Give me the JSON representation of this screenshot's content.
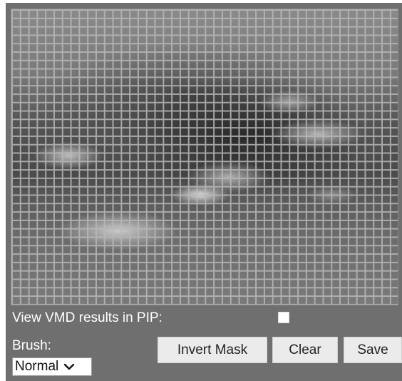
{
  "pip": {
    "label": "View VMD results in PIP:",
    "checked": false
  },
  "brush": {
    "label": "Brush:",
    "selected": "Normal"
  },
  "buttons": {
    "invert_mask": "Invert Mask",
    "clear": "Clear",
    "save": "Save"
  },
  "colors": {
    "panel": "#6f6f6f",
    "grid_line": "#b9b9b9",
    "button_bg": "#ebebeb"
  },
  "icons": {
    "select_arrow": "chevron-down-icon"
  }
}
